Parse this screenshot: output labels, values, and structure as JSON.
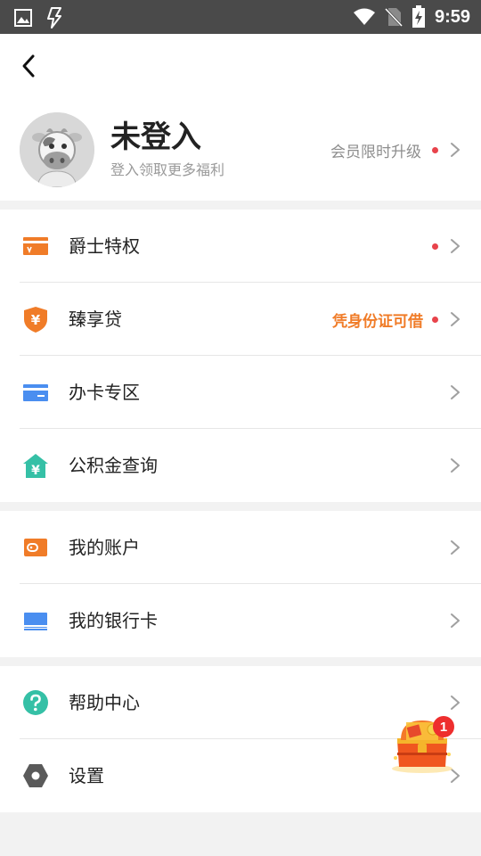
{
  "status_bar": {
    "time": "9:59",
    "left_icons": [
      "image-icon",
      "lightning-icon"
    ],
    "right_icons": [
      "wifi-icon",
      "no-sim-icon",
      "battery-charging-icon"
    ]
  },
  "header": {
    "back_icon": "back-arrow-icon",
    "avatar_icon": "cow-avatar",
    "user_name": "未登入",
    "user_sub": "登入领取更多福利",
    "upgrade_text": "会员限时升级"
  },
  "group1": [
    {
      "id": "jueshi",
      "icon": "card-v-icon",
      "label": "爵士特权",
      "extra": "",
      "dot": true
    },
    {
      "id": "zhenxiangdai",
      "icon": "yen-shield-icon",
      "label": "臻享贷",
      "extra": "凭身份证可借",
      "dot": true
    },
    {
      "id": "banka",
      "icon": "credit-card-icon",
      "label": "办卡专区",
      "extra": "",
      "dot": false
    },
    {
      "id": "gongjijin",
      "icon": "yen-house-icon",
      "label": "公积金查询",
      "extra": "",
      "dot": false
    }
  ],
  "group2": [
    {
      "id": "account",
      "icon": "wallet-icon",
      "label": "我的账户",
      "extra": "",
      "dot": false
    },
    {
      "id": "bankcard",
      "icon": "bank-card-icon",
      "label": "我的银行卡",
      "extra": "",
      "dot": false
    }
  ],
  "group3": [
    {
      "id": "help",
      "icon": "help-icon",
      "label": "帮助中心",
      "extra": "",
      "dot": false
    },
    {
      "id": "settings",
      "icon": "hexagon-settings-icon",
      "label": "设置",
      "extra": "",
      "dot": false
    }
  ],
  "floating": {
    "icon": "treasure-chest-icon",
    "badge": "1"
  },
  "colors": {
    "status_bar": "#4a4a4a",
    "orange": "#f07c28",
    "blue": "#4a8ef0",
    "teal": "#35c0a6",
    "red_dot": "#e8434b",
    "gray_icon": "#5a5a5a"
  }
}
